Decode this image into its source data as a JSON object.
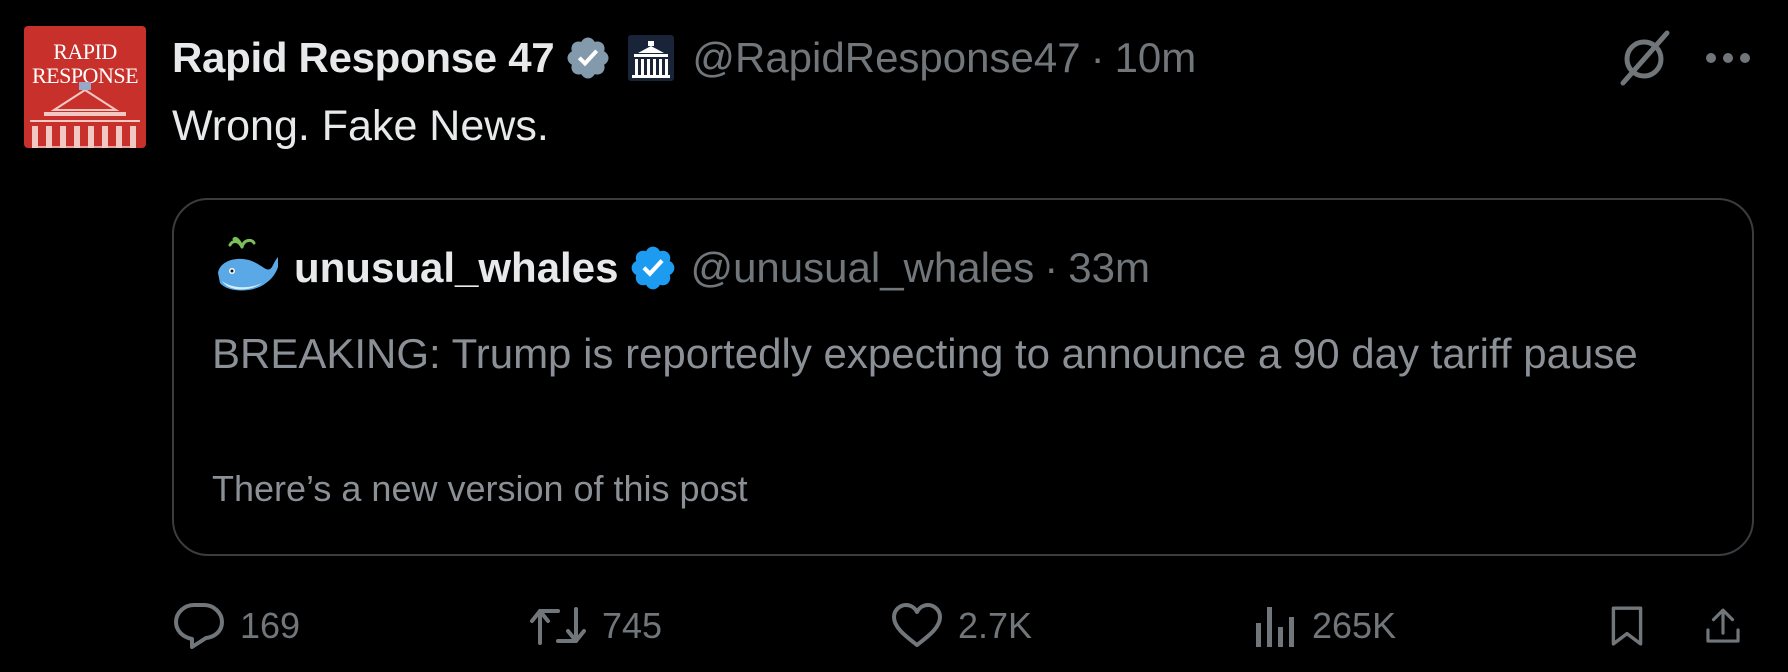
{
  "post": {
    "author": {
      "display_name": "Rapid Response 47",
      "handle": "@RapidResponse47",
      "avatar_line1": "RAPID",
      "avatar_line2": "RESPONSE",
      "verified": true,
      "affiliation_icon": "white-house-icon"
    },
    "separator": "·",
    "time": "10m",
    "text": "Wrong. Fake News."
  },
  "quoted_post": {
    "author": {
      "display_name": "unusual_whales",
      "handle": "@unusual_whales",
      "avatar_icon": "whale-icon",
      "verified": true
    },
    "separator": "·",
    "time": "33m",
    "text": "BREAKING: Trump is reportedly expecting to announce a 90 day tariff pause",
    "edit_notice": "There’s a new version of this post"
  },
  "actions": {
    "replies": "169",
    "reposts": "745",
    "likes": "2.7K",
    "views": "265K"
  },
  "colors": {
    "background": "#000000",
    "primary_text": "#e7e9ea",
    "secondary_text": "#71767b",
    "verified_blue": "#1d9bf0",
    "verified_gray": "#829aab",
    "avatar_red": "#c8312b"
  }
}
